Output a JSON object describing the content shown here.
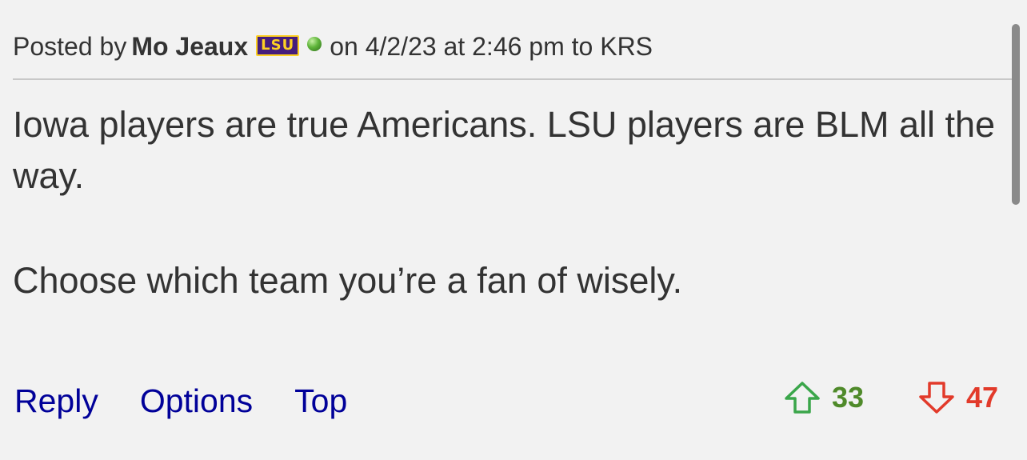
{
  "post": {
    "posted_by_prefix": "Posted by",
    "author": "Mo Jeaux",
    "team_badge": "LSU",
    "meta": "on 4/2/23 at 2:46 pm to KRS",
    "body": [
      "Iowa players are true Americans. LSU players are BLM all the way.",
      "Choose which team you’re a fan of wisely."
    ]
  },
  "actions": {
    "reply": "Reply",
    "options": "Options",
    "top": "Top"
  },
  "votes": {
    "up_count": "33",
    "down_count": "47",
    "up_color": "#4f8a2a",
    "down_color": "#e23a2a",
    "up_icon": "arrow-up-outline-icon",
    "down_icon": "arrow-down-outline-icon"
  },
  "colors": {
    "background": "#f2f2f2",
    "text": "#333333",
    "link": "#000099",
    "team_purple": "#461d7c",
    "team_gold": "#fdd023"
  }
}
